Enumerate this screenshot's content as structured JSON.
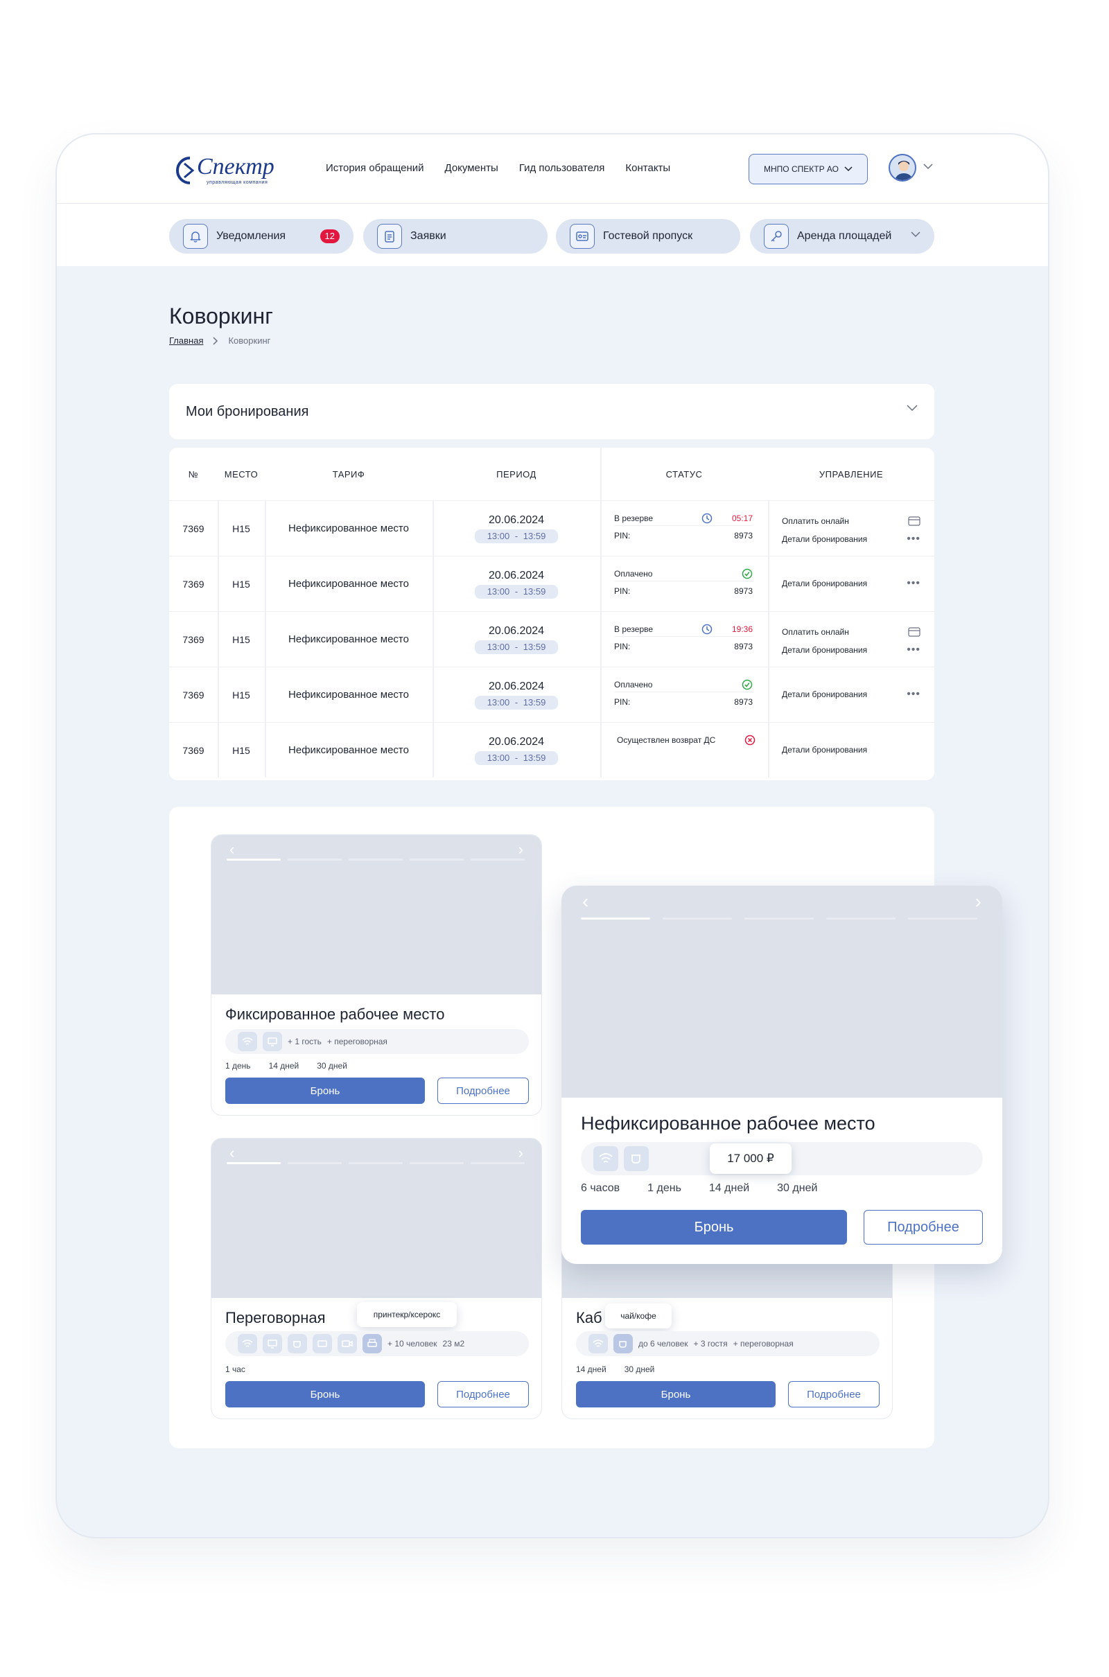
{
  "header": {
    "logo_text": "Спектр",
    "logo_sub": "управляющая компания",
    "nav": [
      "История обращений",
      "Документы",
      "Гид пользователя",
      "Контакты"
    ],
    "company": "МНПО СПЕКТР АО"
  },
  "subnav": {
    "notifications": "Уведомления",
    "notifications_count": "12",
    "requests": "Заявки",
    "guest_pass": "Гостевой пропуск",
    "rent": "Аренда площадей"
  },
  "page": {
    "title": "Коворкинг",
    "breadcrumb_home": "Главная",
    "breadcrumb_current": "Коворкинг"
  },
  "bookings": {
    "accordion_title": "Мои бронирования",
    "columns": [
      "№",
      "МЕСТО",
      "ТАРИФ",
      "ПЕРИОД",
      "СТАТУС",
      "УПРАВЛЕНИЕ"
    ],
    "rows": [
      {
        "num": "7369",
        "place": "H15",
        "tariff": "Нефиксированное место",
        "date": "20.06.2024",
        "time": "13:00 - 13:59",
        "status": "В резерве",
        "timer": "05:17",
        "pin_label": "PIN:",
        "pin": "8973",
        "action1": "Оплатить онлайн",
        "action2": "Детали бронирования"
      },
      {
        "num": "7369",
        "place": "H15",
        "tariff": "Нефиксированное место",
        "date": "20.06.2024",
        "time": "13:00 - 13:59",
        "status": "Оплачено",
        "timer": "",
        "pin_label": "PIN:",
        "pin": "8973",
        "action1": "",
        "action2": "Детали бронирования"
      },
      {
        "num": "7369",
        "place": "H15",
        "tariff": "Нефиксированное место",
        "date": "20.06.2024",
        "time": "13:00 - 13:59",
        "status": "В резерве",
        "timer": "19:36",
        "pin_label": "PIN:",
        "pin": "8973",
        "action1": "Оплатить онлайн",
        "action2": "Детали бронирования"
      },
      {
        "num": "7369",
        "place": "H15",
        "tariff": "Нефиксированное место",
        "date": "20.06.2024",
        "time": "13:00 - 13:59",
        "status": "Оплачено",
        "timer": "",
        "pin_label": "PIN:",
        "pin": "8973",
        "action1": "",
        "action2": "Детали бронирования"
      },
      {
        "num": "7369",
        "place": "H15",
        "tariff": "Нефиксированное место",
        "date": "20.06.2024",
        "time": "13:00 - 13:59",
        "status": "Осуществлен возврат ДС",
        "timer": "",
        "pin_label": "",
        "pin": "",
        "action1": "",
        "action2": "Детали бронирования"
      }
    ]
  },
  "cards": {
    "fixed": {
      "title": "Фиксированное рабочее место",
      "tag1": "+ 1 гость",
      "tag2": "+ переговорная",
      "durations": [
        "1 день",
        "14 дней",
        "30 дней"
      ],
      "book": "Бронь",
      "more": "Подробнее"
    },
    "floating": {
      "title": "Нефиксированное рабочее место",
      "price": "17 000 ₽",
      "durations": [
        "6 часов",
        "1 день",
        "14 дней",
        "30 дней"
      ],
      "book": "Бронь",
      "more": "Подробнее"
    },
    "meeting": {
      "title": "Переговорная",
      "tooltip": "принтекр/ксерокс",
      "tag1": "+ 10 человек",
      "tag2": "23 м2",
      "durations": [
        "1 час"
      ],
      "book": "Бронь",
      "more": "Подробнее"
    },
    "cabinet": {
      "title": "Каб",
      "tooltip": "чай/кофе",
      "tag1": "до 6 человек",
      "tag2": "+ 3 гостя",
      "tag3": "+ переговорная",
      "durations": [
        "14 дней",
        "30 дней"
      ],
      "book": "Бронь",
      "more": "Подробнее"
    }
  },
  "colors": {
    "accent": "#4d72c4",
    "badge": "#e3173e",
    "success": "#2ea84a",
    "background": "#eef2f9"
  }
}
